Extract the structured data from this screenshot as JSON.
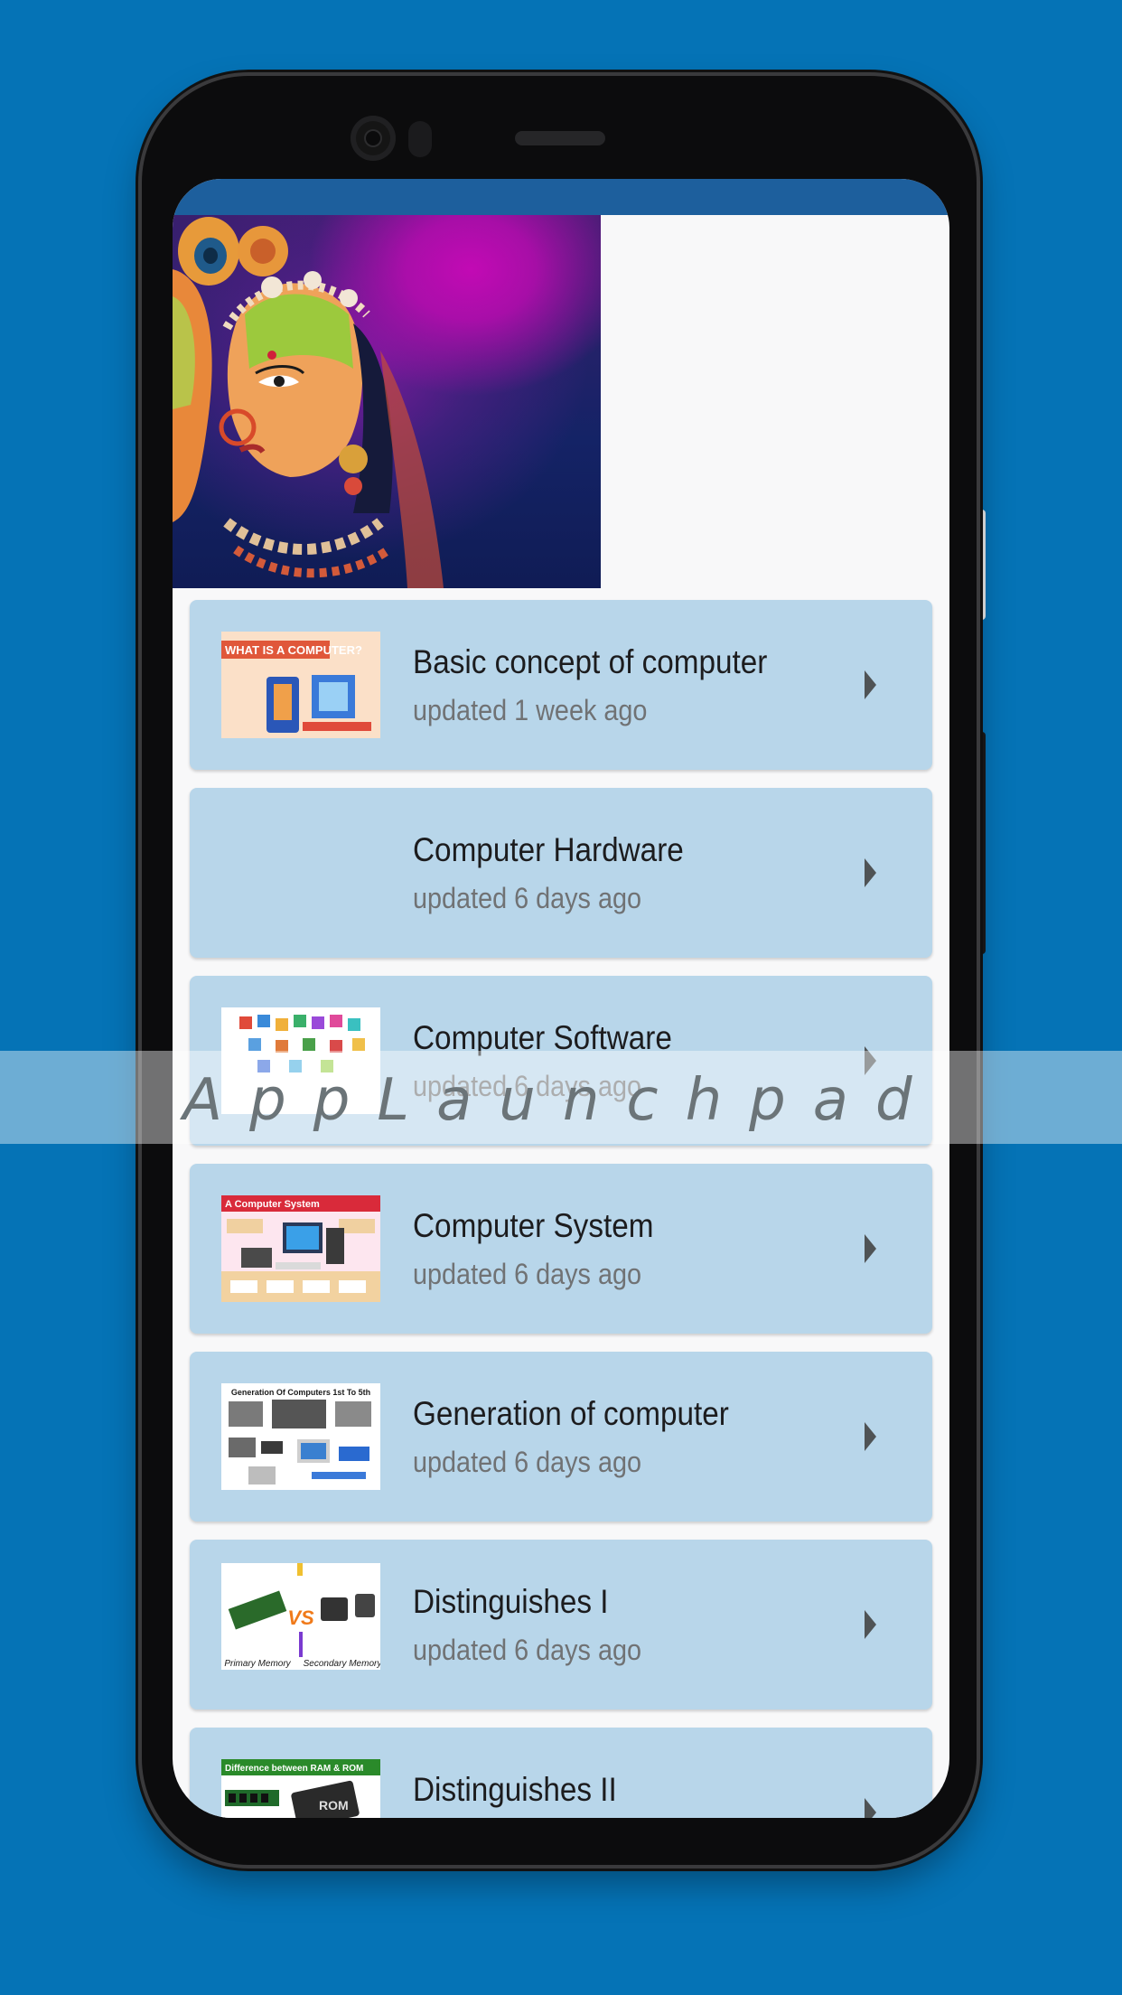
{
  "colors": {
    "background": "#0573b6",
    "status_bar": "#1d5f9d",
    "card": "#b8d6ea",
    "screen": "#f8f8f9"
  },
  "watermark": "AppLaunchpad",
  "banner": {
    "icon": "krishna-radha-painting"
  },
  "chapters": [
    {
      "title": "Basic concept of computer",
      "updated": "updated 1 week ago",
      "thumb_caption": "WHAT IS A COMPUTER?"
    },
    {
      "title": "Computer Hardware",
      "updated": "updated 6 days ago"
    },
    {
      "title": "Computer Software",
      "updated": "updated 6 days ago"
    },
    {
      "title": "Computer System",
      "updated": "updated 6 days ago",
      "thumb_caption": "A Computer System"
    },
    {
      "title": "Generation of computer",
      "updated": "updated 6 days ago",
      "thumb_caption": "Generation Of Computers 1st To 5th"
    },
    {
      "title": "Distinguishes I",
      "updated": "updated 6 days ago",
      "thumb_caption_left": "Primary Memory",
      "thumb_caption_right": "Secondary Memory",
      "thumb_vs": "VS"
    },
    {
      "title": "Distinguishes II",
      "thumb_caption": "Difference between RAM & ROM",
      "thumb_chip_label": "ROM"
    }
  ]
}
